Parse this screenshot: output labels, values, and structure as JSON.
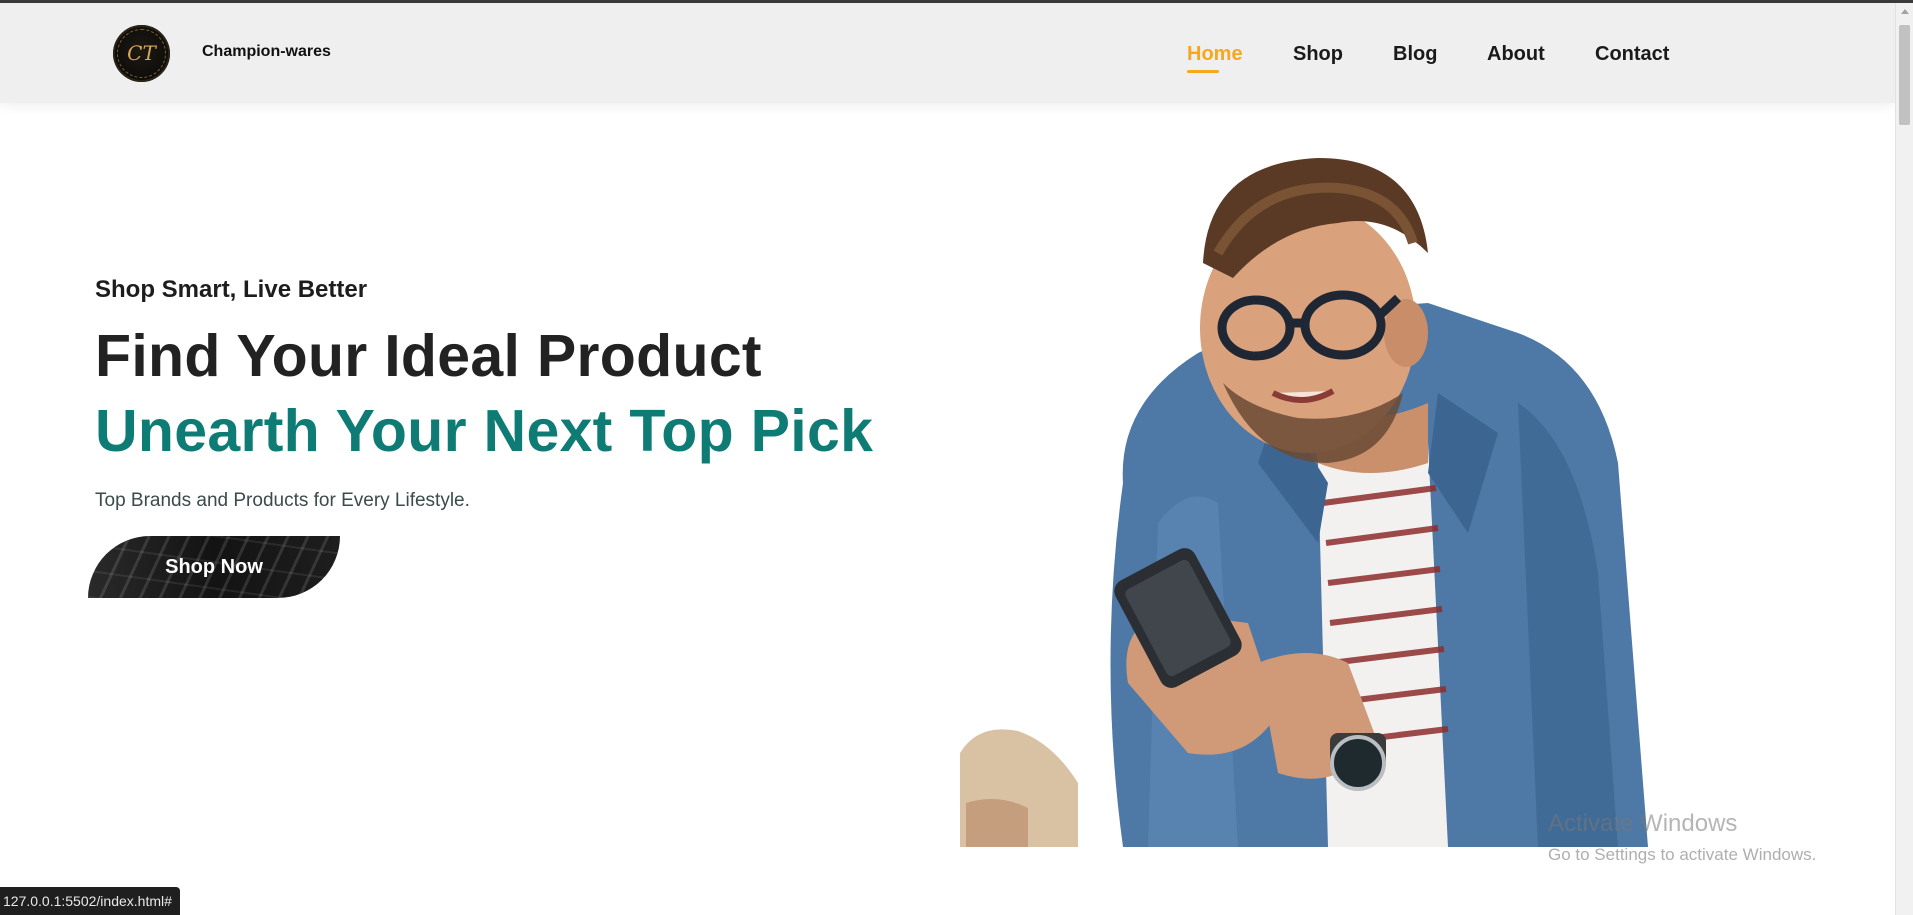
{
  "header": {
    "brand_name": "Champion-wares",
    "logo_monogram": "CT",
    "nav": [
      {
        "label": "Home",
        "active": true
      },
      {
        "label": "Shop",
        "active": false
      },
      {
        "label": "Blog",
        "active": false
      },
      {
        "label": "About",
        "active": false
      },
      {
        "label": "Contact",
        "active": false
      }
    ]
  },
  "hero": {
    "tagline": "Shop Smart, Live Better",
    "headline": "Find Your Ideal Product",
    "headline_accent": "Unearth Your Next Top Pick",
    "subtext": "Top Brands and Products for Every Lifestyle.",
    "cta_label": "Shop Now"
  },
  "status_bar": {
    "url": "127.0.0.1:5502/index.html#"
  },
  "watermark": {
    "title": "Activate Windows",
    "subtitle": "Go to Settings to activate Windows."
  },
  "colors": {
    "accent": "#f4a81d",
    "teal": "#0e7c75",
    "header_bg": "#efefef"
  },
  "icons": {
    "logo": "circular-monogram-logo"
  }
}
